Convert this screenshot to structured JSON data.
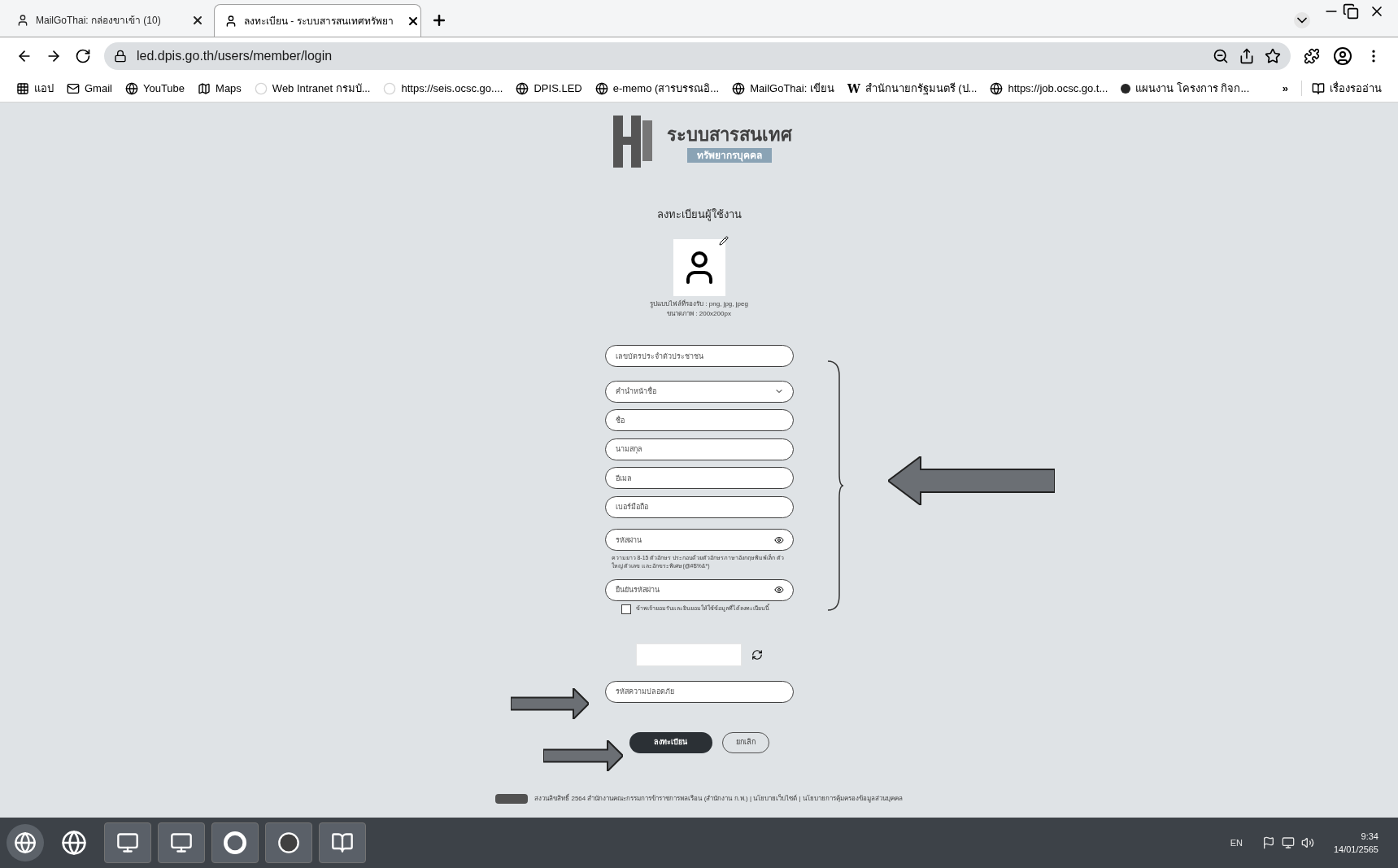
{
  "browser": {
    "tabs": [
      {
        "title": "MailGoThai: กล่องขาเข้า (10)",
        "selected": false
      },
      {
        "title": "ลงทะเบียน - ระบบสารสนเทศทรัพยา",
        "selected": true
      }
    ],
    "url": "led.dpis.go.th/users/member/login",
    "bookmarks": [
      {
        "label": "แอป",
        "kind": "apps"
      },
      {
        "label": "Gmail",
        "kind": "mail"
      },
      {
        "label": "YouTube",
        "kind": "globe"
      },
      {
        "label": "Maps",
        "kind": "map"
      },
      {
        "label": "Web Intranet กรมบั...",
        "kind": "blank"
      },
      {
        "label": "https://seis.ocsc.go....",
        "kind": "blank"
      },
      {
        "label": "DPIS.LED",
        "kind": "globe"
      },
      {
        "label": "e-memo (สารบรรณอิ...",
        "kind": "globe"
      },
      {
        "label": "MailGoThai: เขียน",
        "kind": "globe"
      },
      {
        "label": "สำนักนายกรัฐมนตรี (ป...",
        "kind": "wiki",
        "icon_text": "W"
      },
      {
        "label": "https://job.ocsc.go.t...",
        "kind": "globe"
      },
      {
        "label": "แผนงาน โครงการ กิจก...",
        "kind": "dot"
      }
    ],
    "overflow": "»",
    "reading_list": "เรื่องรออ่าน"
  },
  "page": {
    "logo_title": "ระบบสารสนเทศ",
    "logo_subtitle": "ทรัพยากรบุคคล",
    "heading": "ลงทะเบียนผู้ใช้งาน",
    "photo_hints": [
      "รูปแบบไฟล์ที่รองรับ : png, jpg, jpeg",
      "ขนาดภาพ : 200x200px"
    ],
    "fields": [
      {
        "placeholder": "เลขบัตรประจำตัวประชาชน",
        "kind": "text"
      },
      {
        "placeholder": "คำนำหน้าชื่อ",
        "kind": "select"
      },
      {
        "placeholder": "ชื่อ",
        "kind": "text"
      },
      {
        "placeholder": "นามสกุล",
        "kind": "text"
      },
      {
        "placeholder": "อีเมล",
        "kind": "text"
      },
      {
        "placeholder": "เบอร์มือถือ",
        "kind": "text"
      },
      {
        "placeholder": "รหัสผ่าน",
        "kind": "password",
        "hint": "ความยาว 8-15 ตัวอักษร ประกอบด้วยตัวอักษรภาษาอังกฤษพิมพ์เล็ก ตัวใหญ่ ตัวเลข และอักขระพิเศษ(@#$%&*)"
      },
      {
        "placeholder": "ยืนยันรหัสผ่าน",
        "kind": "password"
      }
    ],
    "consent": {
      "label": "ข้าพเจ้ายอมรับและยินยอมให้ใช้ข้อมูลที่ได้ลงทะเบียนนี้",
      "checked": false
    },
    "captcha_field": {
      "placeholder": "รหัสความปลอดภัย"
    },
    "buttons": [
      {
        "label": "ลงทะเบียน",
        "kind": "primary"
      },
      {
        "label": "ยกเลิก",
        "kind": "outline"
      }
    ],
    "footer": "สงวนลิขสิทธิ์ 2564 สำนักงานคณะกรรมการข้าราชการพลเรือน (สำนักงาน ก.พ.) | นโยบายเว็บไซต์ | นโยบายการคุ้มครองข้อมูลส่วนบุคคล"
  },
  "taskbar": {
    "language": "EN",
    "time": "9:34",
    "date": "14/01/2565"
  }
}
